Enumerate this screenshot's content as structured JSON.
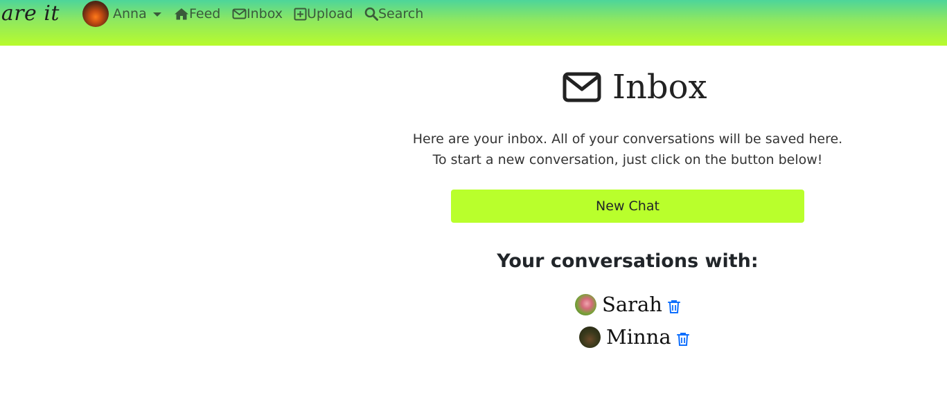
{
  "navbar": {
    "brand": "hare it",
    "user": {
      "name": "Anna"
    },
    "links": {
      "feed": "Feed",
      "inbox": "Inbox",
      "upload": "Upload",
      "search": "Search"
    },
    "icons": [
      "house-icon",
      "envelope-icon",
      "plus-square-icon",
      "search-icon",
      "caret-down-icon"
    ]
  },
  "page": {
    "title": "Inbox",
    "intro_line1": "Here are your inbox. All of your conversations will be saved here.",
    "intro_line2": "To start a new conversation, just click on the button below!",
    "new_chat_label": "New Chat",
    "conversations_heading": "Your conversations with:"
  },
  "conversations": [
    {
      "name": "Sarah",
      "action_icon": "trash-icon"
    },
    {
      "name": "Minna",
      "action_icon": "trash-icon"
    }
  ],
  "colors": {
    "navbar_gradient_top": "#4dd59a",
    "navbar_gradient_bottom": "#b8fb2c",
    "button_bg": "#b9ff2c",
    "trash_icon": "#0d6efd"
  }
}
